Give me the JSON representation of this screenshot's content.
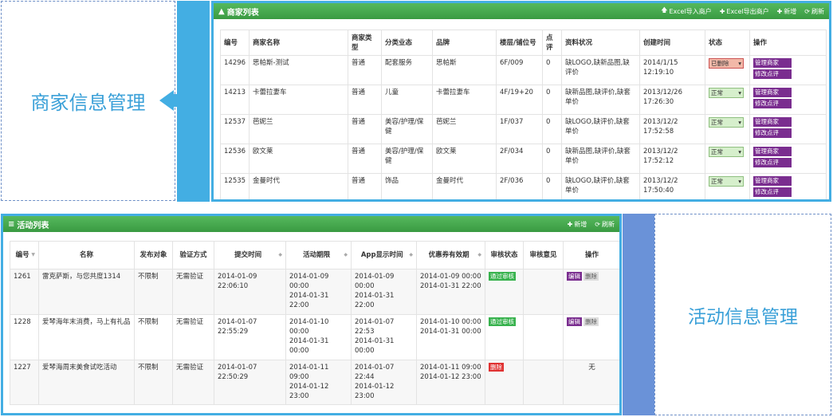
{
  "labels": {
    "merchant": "商家信息管理",
    "activity": "活动信息管理"
  },
  "colors": {
    "bar_blue": "#43aee3",
    "bar_blue2": "#6a92d8",
    "header_green": "#3a9a42",
    "op_purple": "#7a2d8f"
  },
  "merchant_panel": {
    "title": "商家列表",
    "tools": {
      "import": "Excel导入商户",
      "export": "Excel导出商户",
      "add": "新增",
      "refresh": "刷新"
    },
    "columns": [
      "编号",
      "商家名称",
      "商家类型",
      "分类业态",
      "品牌",
      "楼层/铺位号",
      "点评",
      "资料状况",
      "创建时间",
      "状态",
      "操作"
    ],
    "rows": [
      {
        "id": "14296",
        "name": "思帕斯-测试",
        "type": "普通",
        "category": "配套服务",
        "brand": "思帕斯",
        "floor": "6F/009",
        "reviews": "0",
        "info": "缺LOGO,缺新品图,缺评价",
        "created": "2014/1/15 12:19:10",
        "status": "已删除",
        "deleted": true
      },
      {
        "id": "14213",
        "name": "卡蕾拉妻车",
        "type": "普通",
        "category": "儿童",
        "brand": "卡蕾拉妻车",
        "floor": "4F/19+20",
        "reviews": "0",
        "info": "缺新品图,缺评价,缺套单价",
        "created": "2013/12/26 17:26:30",
        "status": "正常",
        "deleted": false
      },
      {
        "id": "12537",
        "name": "芭妮兰",
        "type": "普通",
        "category": "美容/护理/保健",
        "brand": "芭妮兰",
        "floor": "1F/037",
        "reviews": "0",
        "info": "缺LOGO,缺评价,缺套单价",
        "created": "2013/12/2 17:52:58",
        "status": "正常",
        "deleted": false
      },
      {
        "id": "12536",
        "name": "欧文莱",
        "type": "普通",
        "category": "美容/护理/保健",
        "brand": "欧文莱",
        "floor": "2F/034",
        "reviews": "0",
        "info": "缺新品图,缺评价,缺套单价",
        "created": "2013/12/2 17:52:12",
        "status": "正常",
        "deleted": false
      },
      {
        "id": "12535",
        "name": "金曼时代",
        "type": "普通",
        "category": "饰品",
        "brand": "金曼时代",
        "floor": "2F/036",
        "reviews": "0",
        "info": "缺LOGO,缺评价,缺套单价",
        "created": "2013/12/2 17:50:40",
        "status": "正常",
        "deleted": false
      }
    ],
    "op_labels": {
      "manage": "管理商家",
      "edit_review": "修改点评"
    },
    "select_arrow": "▾"
  },
  "activity_panel": {
    "title": "活动列表",
    "tools": {
      "add": "新增",
      "refresh": "刷新"
    },
    "columns": [
      "编号",
      "名称",
      "发布对象",
      "验证方式",
      "提交时间",
      "活动期限",
      "App显示时间",
      "优惠券有效期",
      "审核状态",
      "审核意见",
      "操作"
    ],
    "rows": [
      {
        "id": "1261",
        "name": "雷克萨斯，与您共度1314",
        "target": "不限制",
        "verify": "无需验证",
        "submitted": "2014-01-09 22:06:10",
        "period": "2014-01-09 00:00\n2014-01-31 22:00",
        "app_time": "2014-01-09 00:00\n2014-01-31 22:00",
        "coupon": "2014-01-09 00:00\n2014-01-31 22:00",
        "audit": "通过审核",
        "audit_type": "pass",
        "opinion": "",
        "op": "edit"
      },
      {
        "id": "1228",
        "name": "爱琴海年末消费，马上有礼品",
        "target": "不限制",
        "verify": "无需验证",
        "submitted": "2014-01-07 22:55:29",
        "period": "2014-01-10 00:00\n2014-01-31 00:00",
        "app_time": "2014-01-07 22:53\n2014-01-31 00:00",
        "coupon": "2014-01-10 00:00\n2014-01-31 00:00",
        "audit": "通过审核",
        "audit_type": "pass",
        "opinion": "",
        "op": "edit"
      },
      {
        "id": "1227",
        "name": "爱琴海周末美食试吃活动",
        "target": "不限制",
        "verify": "无需验证",
        "submitted": "2014-01-07 22:50:29",
        "period": "2014-01-11 09:00\n2014-01-12 23:00",
        "app_time": "2014-01-07 22:44\n2014-01-12 23:00",
        "coupon": "2014-01-11 09:00\n2014-01-12 23:00",
        "audit": "删除",
        "audit_type": "deleted",
        "opinion": "",
        "op": "none"
      }
    ],
    "op_labels": {
      "edit": "编辑",
      "delete": "删除",
      "none": "无"
    }
  }
}
